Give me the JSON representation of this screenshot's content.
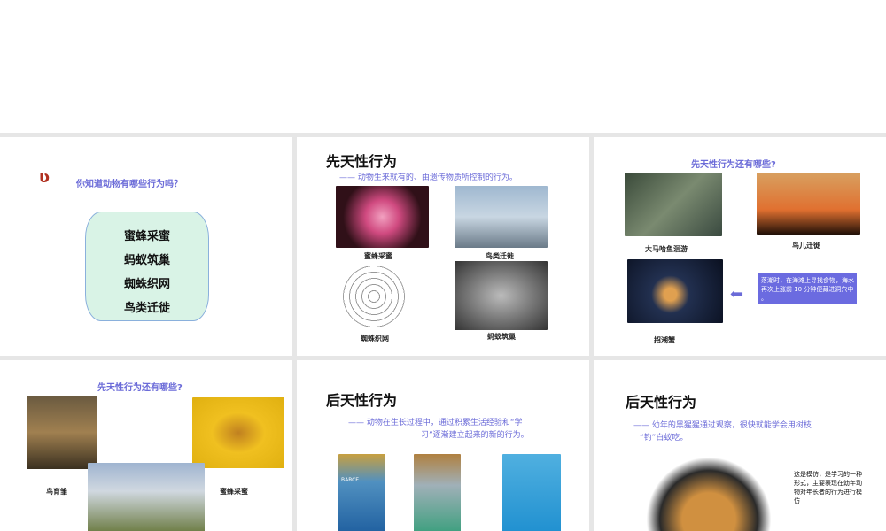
{
  "slide1": {
    "question": "你知道动物有哪些行为吗？",
    "items": [
      "蜜蜂采蜜",
      "蚂蚁筑巢",
      "蜘蛛织网",
      "鸟类迁徙"
    ]
  },
  "slide2": {
    "title": "先天性行为",
    "subtitle": "—— 动物生来就有的、由遗传物质所控制的行为。",
    "captions": [
      "蜜蜂采蜜",
      "鸟类迁徙",
      "蜘蛛织网",
      "蚂蚁筑巢"
    ]
  },
  "slide3": {
    "title": "先天性行为还有哪些?",
    "captions": [
      "大马哈鱼洄游",
      "鸟儿迁徙",
      "招潮蟹"
    ],
    "note": "落潮时，在海滩上寻找食物，海水再次上涨前 10 分钟便藏进洞穴中 。"
  },
  "slide4": {
    "title": "先天性行为还有哪些?",
    "captions": [
      "鸟育雏",
      "蜜蜂采蜜"
    ]
  },
  "slide5": {
    "title": "后天性行为",
    "subtitle_line1": "—— 动物在生长过程中，通过积累生活经验和“学",
    "subtitle_line2": "习”逐渐建立起来的新的行为。",
    "sign": "BARCE"
  },
  "slide6": {
    "title": "后天性行为",
    "subtitle_line1": "—— 幼年的黑猩猩通过观察，很快就能学会用树枝",
    "subtitle_line2": "“钓”白蚁吃。",
    "note": "这是模仿，是学习的一种形式，主要表现在幼年动物对年长者的行为进行模仿"
  }
}
